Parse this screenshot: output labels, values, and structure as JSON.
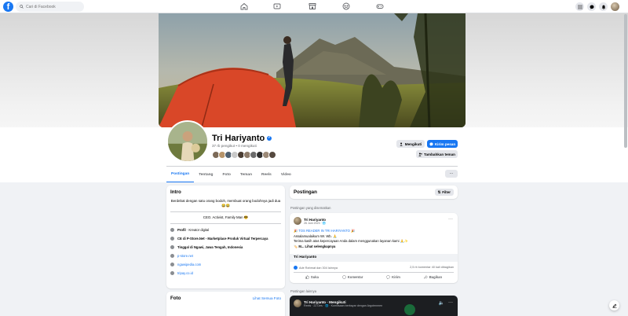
{
  "topbar": {
    "logo": "f",
    "search_placeholder": "Cari di Facebook",
    "nav_icons": [
      "home-icon",
      "video-icon",
      "marketplace-icon",
      "groups-icon",
      "gaming-icon"
    ],
    "notification_badge": "",
    "right_icons": [
      "menu-grid-icon",
      "messenger-icon",
      "bell-icon",
      "account-avatar"
    ]
  },
  "profile": {
    "name": "Tri Hariyanto",
    "stats": "37 rb pengikut • 0 mengikuti",
    "btn_follow": "Mengikuti",
    "btn_message": "Kirim pesan",
    "btn_add_friend": "Tambahkan teman",
    "more": "···",
    "friend_colors": [
      "#7c6a58",
      "#b6946a",
      "#4f6070",
      "#c9c9c9",
      "#4a3d33",
      "#8d7b6a",
      "#6b6b6b",
      "#2f2f2f",
      "#9c8a78",
      "#55493f"
    ]
  },
  "tabs": [
    "Postingan",
    "Tentang",
    "Foto",
    "Teman",
    "Reels",
    "Video"
  ],
  "intro": {
    "title": "Intro",
    "bio": "Berdebat dengan satu orang bodoh, membuat orang bodohnya jadi dua 😂😂",
    "tagline": "CEO. Activist, Family Man 😎",
    "items": [
      {
        "icon": "info-icon",
        "bold": "Profil",
        "text": " · Kreator digital"
      },
      {
        "icon": "work-icon",
        "bold": "",
        "text": "CE di P-Store.Net - Marketplace Produk Virtual Terpercaya"
      },
      {
        "icon": "home-location-icon",
        "bold": "",
        "text": "Tinggal di Ngawi, Jawa Tengah, Indonesia"
      },
      {
        "icon": "link-icon",
        "bold": "",
        "text": "p-store.net"
      },
      {
        "icon": "link-icon",
        "bold": "",
        "text": "ngawipedia.com"
      },
      {
        "icon": "link-icon",
        "bold": "",
        "text": "tripay.co.id"
      }
    ]
  },
  "foto": {
    "title": "Foto",
    "link": "Lihat Semua Foto"
  },
  "posts": {
    "title": "Postingan",
    "filter": "Filter",
    "pinned_label": "Postingan yang disematkan",
    "latest_label": "Postingan lainnya"
  },
  "post": {
    "author": "Tri Hariyanto",
    "date": "26 Juni 2023 · 🌐",
    "line1": "🎉 TOS READER IN TRI HARIYANTO 🎉",
    "line2": "Assalamualaikum Wr. Wb. 🙏",
    "line3": "Terima kasih atas kepercayaan Anda dalam menggunakan layanan kami 🙏✨",
    "line4": "🏷️ M... Lihat selengkapnya",
    "band": "Tri Hariyanto",
    "reactions": "Ade Rahmat dan 304 lainnya",
    "counts": "2,5 rb komentar   40 kali dibagikan",
    "like": "Suka",
    "comment": "Komentar",
    "send": "Kirim",
    "share": "Bagikan"
  },
  "video": {
    "author": "Tri Hariyanto · Mengikuti",
    "sub": "Reels · 22 Des · 🌐 · Komitsaan berbayar dengan Argotenmen"
  }
}
